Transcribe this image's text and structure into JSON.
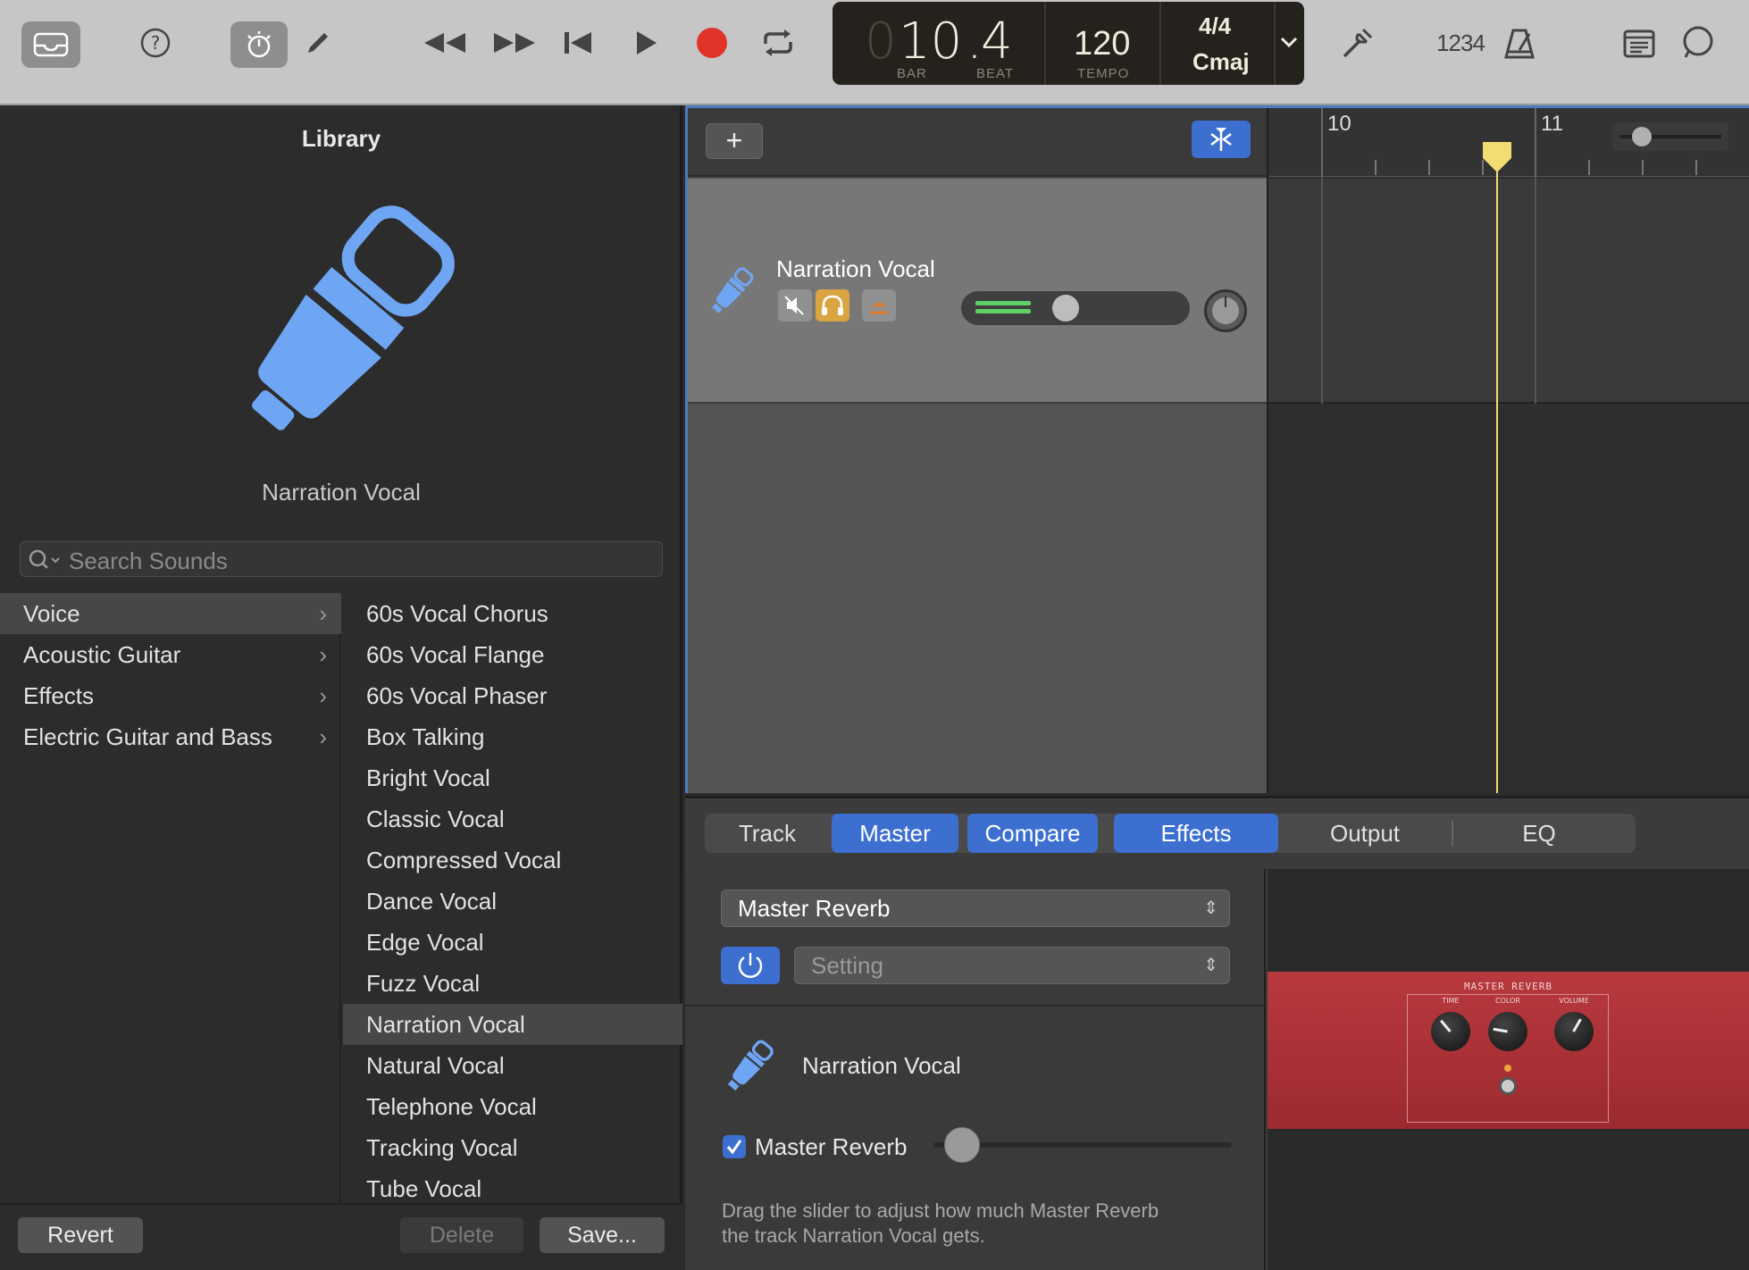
{
  "toolbar": {
    "lcd": {
      "bar": "10",
      "beat": "4",
      "bar_label": "BAR",
      "beat_label": "BEAT",
      "tempo": "120",
      "tempo_label": "TEMPO",
      "time_signature": "4/4",
      "key": "Cmaj"
    },
    "count_in_label": "1234"
  },
  "library": {
    "title": "Library",
    "selected_sound": "Narration Vocal",
    "search_placeholder": "Search Sounds",
    "categories": [
      {
        "label": "Voice",
        "selected": true
      },
      {
        "label": "Acoustic Guitar",
        "selected": false
      },
      {
        "label": "Effects",
        "selected": false
      },
      {
        "label": "Electric Guitar and Bass",
        "selected": false
      }
    ],
    "sounds": [
      {
        "label": "60s Vocal Chorus"
      },
      {
        "label": "60s Vocal Flange"
      },
      {
        "label": "60s Vocal Phaser"
      },
      {
        "label": "Box Talking"
      },
      {
        "label": "Bright Vocal"
      },
      {
        "label": "Classic Vocal"
      },
      {
        "label": "Compressed Vocal"
      },
      {
        "label": "Dance Vocal"
      },
      {
        "label": "Edge Vocal"
      },
      {
        "label": "Fuzz Vocal"
      },
      {
        "label": "Narration Vocal",
        "selected": true
      },
      {
        "label": "Natural Vocal"
      },
      {
        "label": "Telephone Vocal"
      },
      {
        "label": "Tracking Vocal"
      },
      {
        "label": "Tube Vocal"
      }
    ],
    "footer": {
      "revert": "Revert",
      "delete": "Delete",
      "save": "Save..."
    }
  },
  "tracks": {
    "add_label": "+",
    "track_name": "Narration Vocal",
    "ruler_marks": [
      "10",
      "11"
    ]
  },
  "editor": {
    "tabs": [
      "Track",
      "Master",
      "Compare",
      "Effects",
      "Output",
      "EQ"
    ],
    "active_tabs": [
      "Master",
      "Compare",
      "Effects"
    ],
    "effect_select": "Master Reverb",
    "setting_select": "Setting",
    "track_name": "Narration Vocal",
    "reverb_checkbox_label": "Master Reverb",
    "reverb_checked": true,
    "help_line1": "Drag the slider to adjust how much Master Reverb",
    "help_line2": "the track Narration Vocal gets.",
    "pedal": {
      "title": "MASTER REVERB",
      "knob_time": "TIME",
      "knob_color": "COLOR",
      "knob_volume": "VOLUME"
    }
  },
  "colors": {
    "accent": "#3c6fd0",
    "playhead": "#f3dc72",
    "record": "#e0342a",
    "mic_icon": "#6fa6f4",
    "pedal": "#b23840"
  }
}
